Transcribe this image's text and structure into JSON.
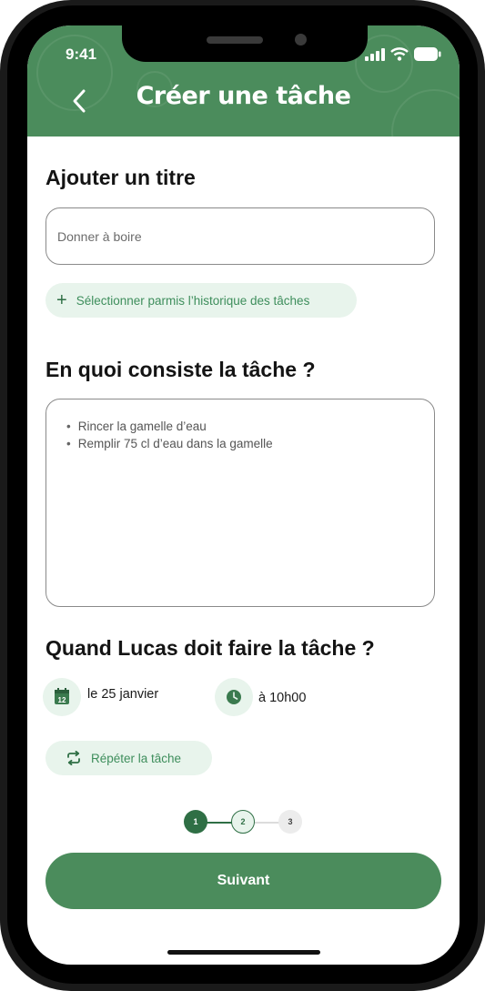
{
  "status_bar": {
    "time": "9:41"
  },
  "header": {
    "title": "Créer une tâche"
  },
  "title_section": {
    "heading": "Ajouter un titre",
    "input_placeholder": "Donner à boire",
    "history_label": "Sélectionner parmis l’historique des tâches"
  },
  "description_section": {
    "heading": "En quoi consiste la tâche ?",
    "items": [
      "Rincer la gamelle d’eau",
      "Remplir 75 cl d’eau dans la gamelle"
    ]
  },
  "schedule_section": {
    "heading": "Quand Lucas doit faire la tâche ?",
    "date": "le 25 janvier",
    "calendar_day": "12",
    "time": "à 10h00",
    "repeat_label": "Répéter la tâche"
  },
  "stepper": {
    "steps": [
      "1",
      "2",
      "3"
    ],
    "current": 1
  },
  "primary_button": "Suivant",
  "colors": {
    "brand_green": "#4b8c5c",
    "light_green": "#e8f4ec",
    "accent_text": "#3e8e5c"
  }
}
